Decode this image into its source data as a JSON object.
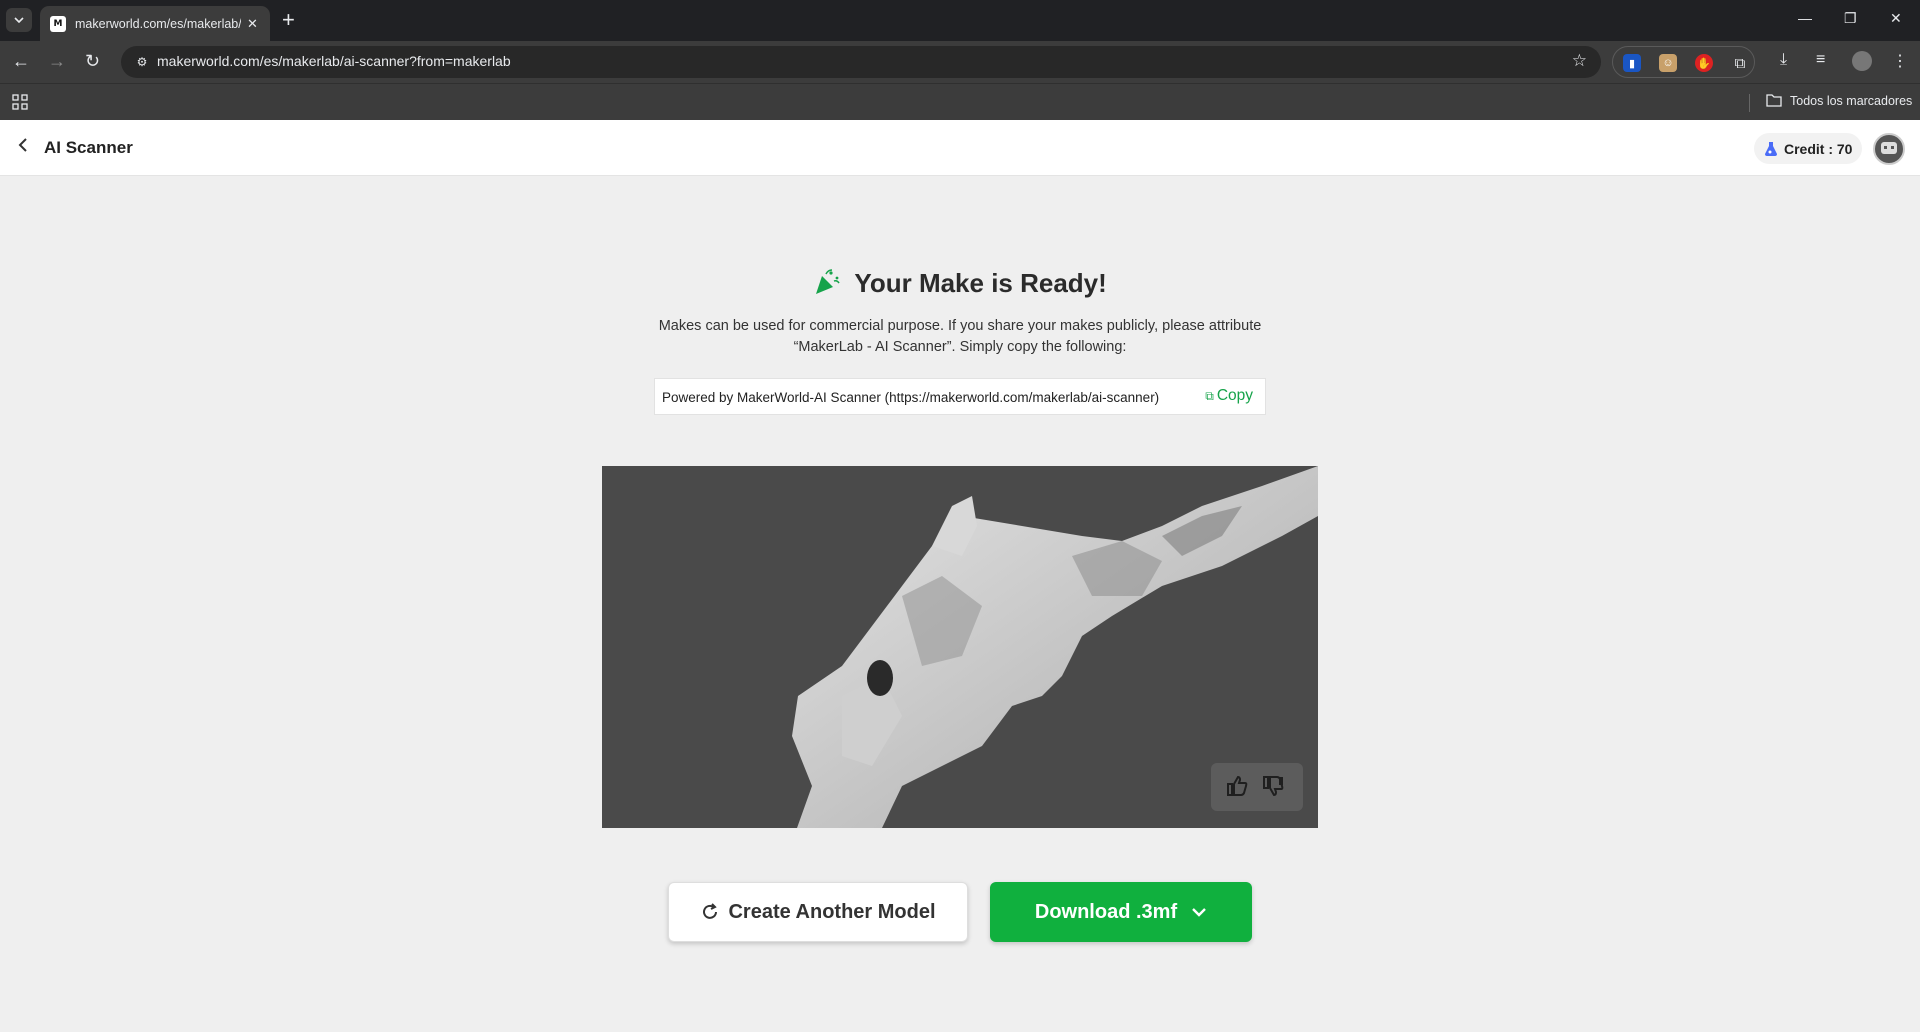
{
  "browser": {
    "tab_title": "makerworld.com/es/makerlab/ai-scanner?from=makerlab",
    "url": "makerworld.com/es/makerlab/ai-scanner?from=makerlab",
    "bookmarks_label": "Todos los marcadores"
  },
  "header": {
    "title": "AI Scanner",
    "credit_label": "Credit : 70"
  },
  "main": {
    "headline": "Your Make is Ready!",
    "description": "Makes can be used for commercial purpose. If you share your makes publicly, please attribute “MakerLab - AI Scanner”. Simply copy the following:",
    "attribution_text": "Powered by MakerWorld-AI Scanner (https://makerworld.com/makerlab/ai-scanner)",
    "copy_label": "Copy",
    "create_another_label": "Create Another Model",
    "download_label": "Download .3mf"
  },
  "icons": {
    "back": "chevron-left-icon",
    "party": "party-popper-icon",
    "copy": "copy-icon",
    "thumbs_up": "thumbs-up-icon",
    "thumbs_down": "thumbs-down-icon",
    "refresh": "refresh-icon",
    "chevron_down": "chevron-down-icon"
  },
  "colors": {
    "accent_green": "#10b03e",
    "viewer_bg": "#4a4a4a"
  }
}
